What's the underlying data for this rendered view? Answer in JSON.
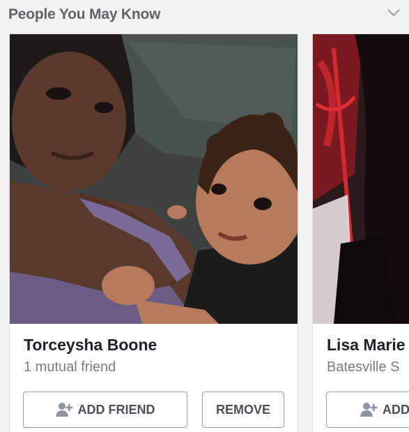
{
  "section": {
    "title": "People You May Know"
  },
  "cards": [
    {
      "name": "Torceysha Boone",
      "subtitle": "1 mutual friend",
      "add_label": "ADD FRIEND",
      "remove_label": "REMOVE"
    },
    {
      "name": "Lisa Marie",
      "subtitle": "Batesville S",
      "add_label": "ADD"
    }
  ],
  "icons": {
    "expand": "chevron-down-icon",
    "add_friend": "add-friend-icon"
  },
  "colors": {
    "background": "#f2f2f2",
    "card": "#ffffff",
    "title_text": "#5f6266",
    "name_text": "#1d2129",
    "secondary_text": "#7a7d82",
    "button_border": "#9a9da2",
    "button_text": "#4b4f56"
  }
}
